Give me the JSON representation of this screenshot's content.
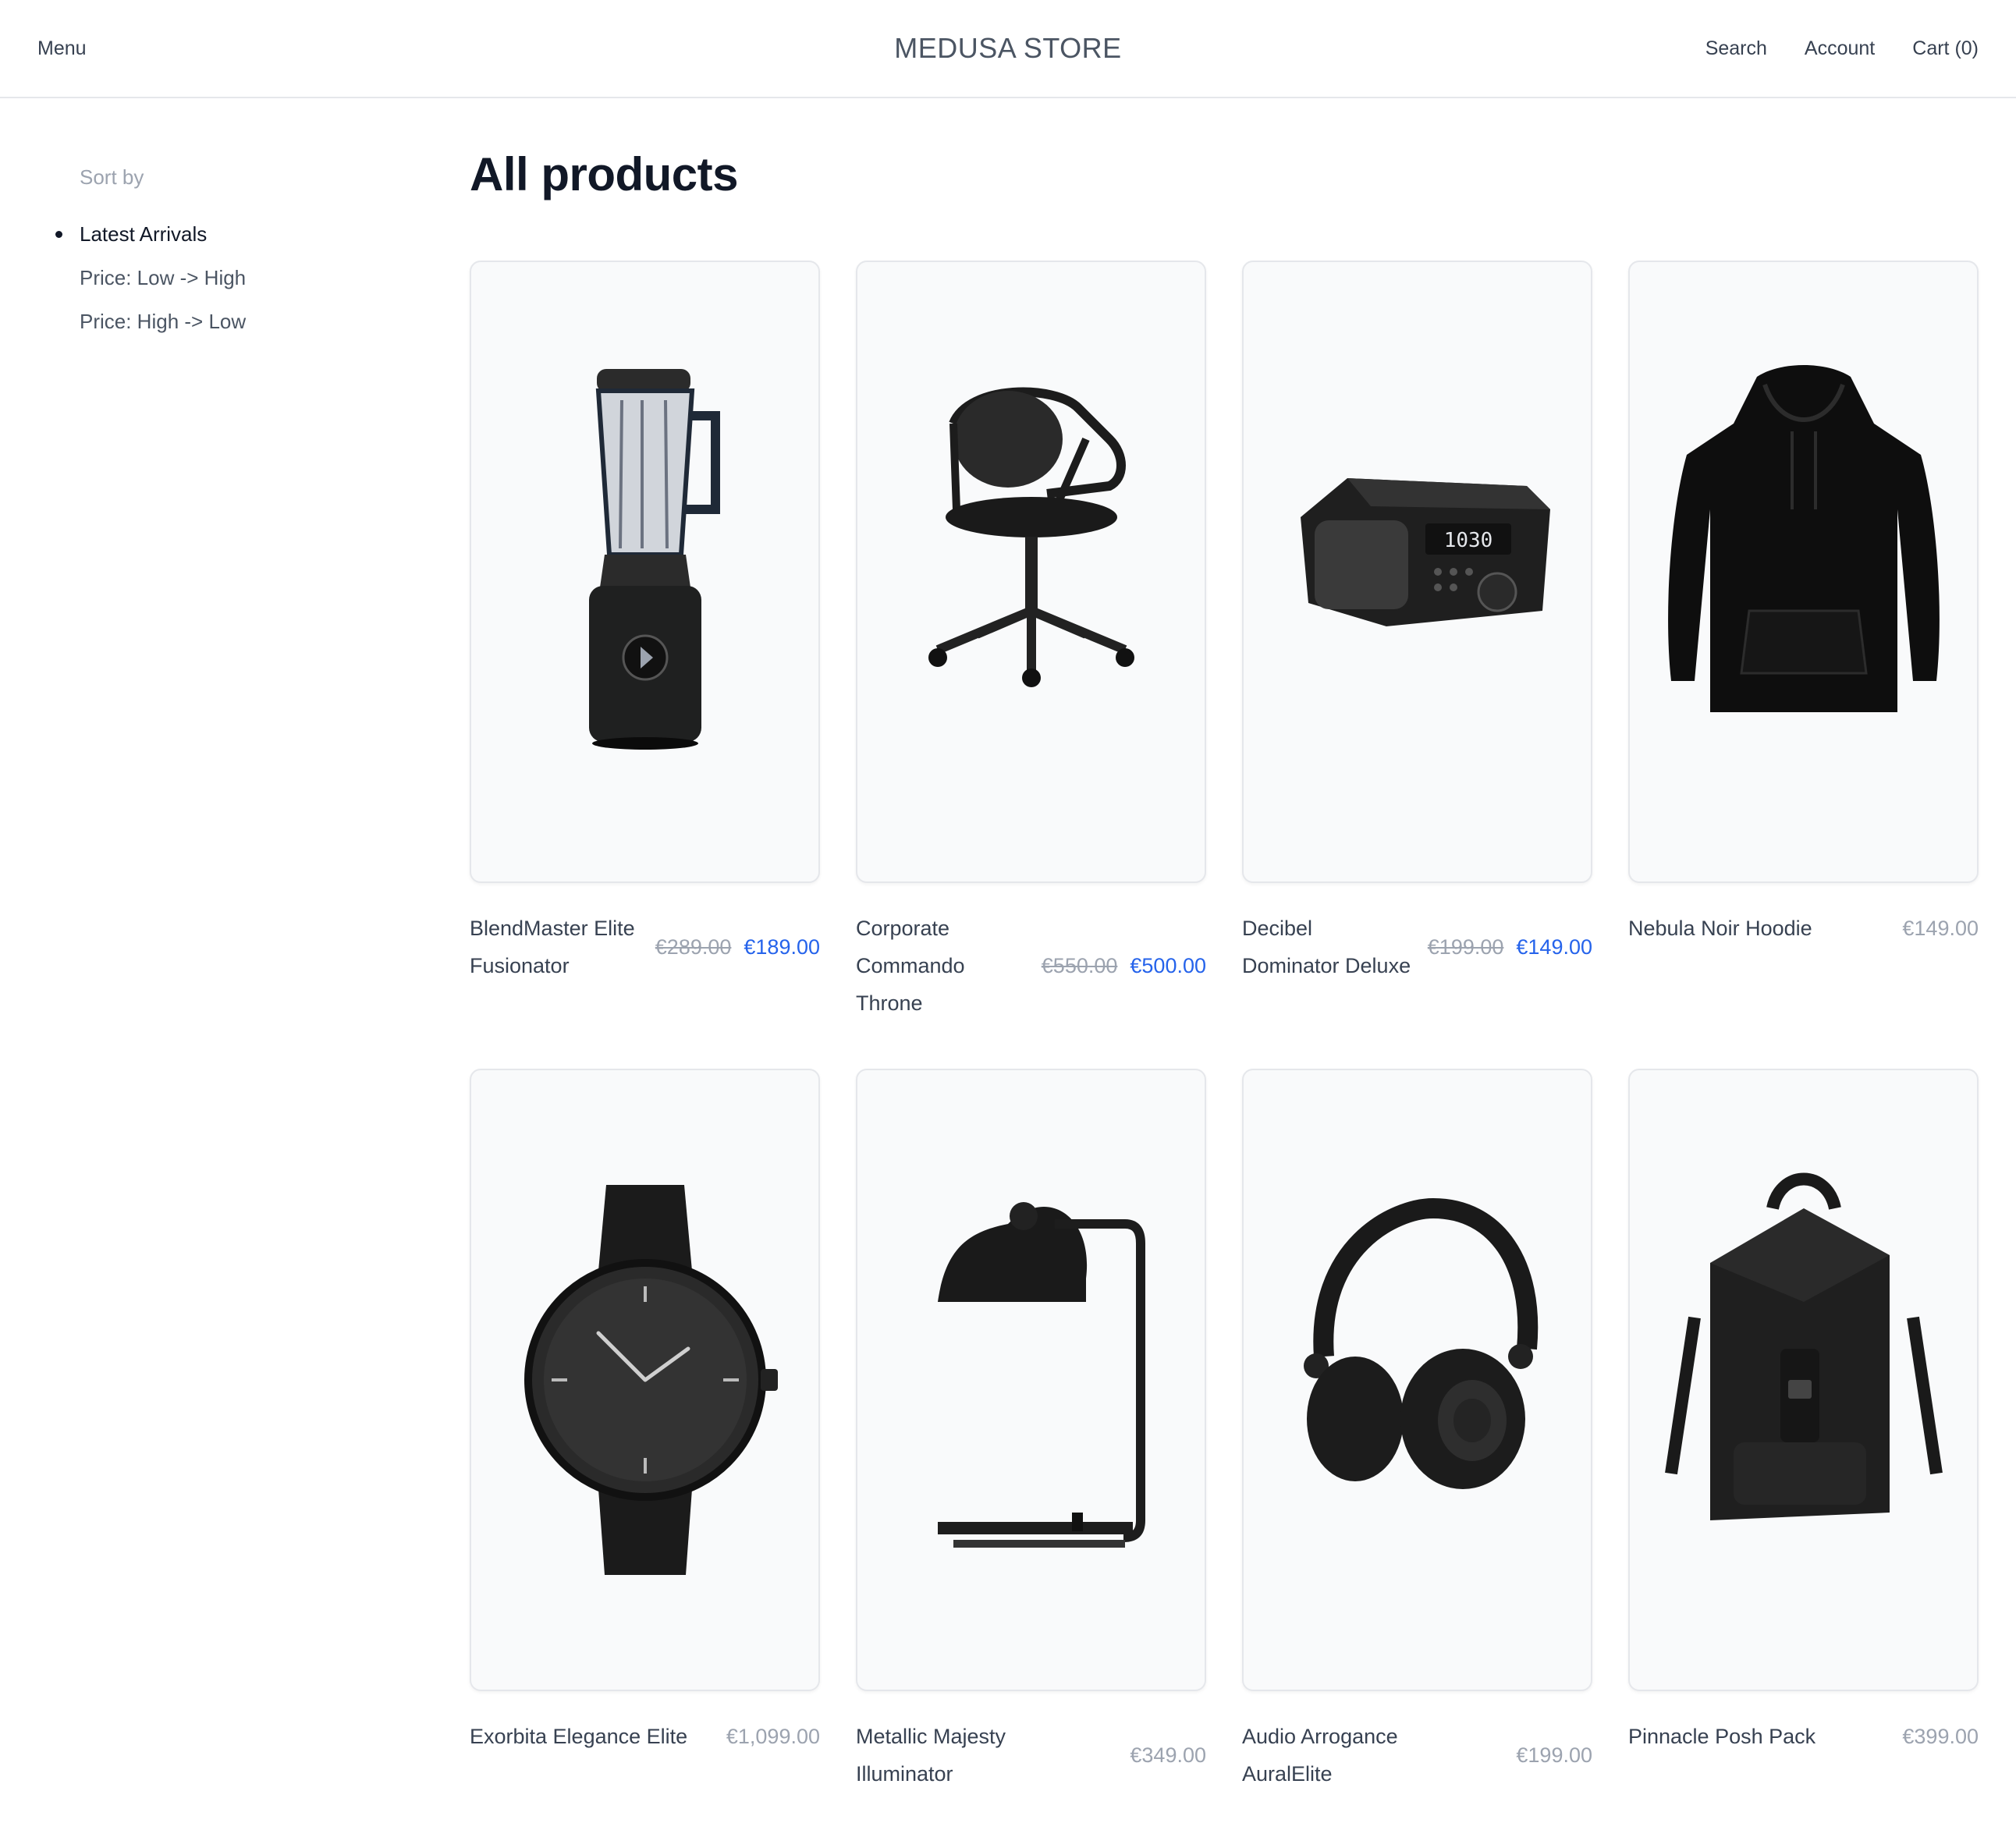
{
  "header": {
    "menu": "Menu",
    "title": "MEDUSA STORE",
    "search": "Search",
    "account": "Account",
    "cart": "Cart (0)"
  },
  "sidebar": {
    "sort_label": "Sort by",
    "options": [
      {
        "label": "Latest Arrivals",
        "selected": true
      },
      {
        "label": "Price: Low -> High",
        "selected": false
      },
      {
        "label": "Price: High -> Low",
        "selected": false
      }
    ]
  },
  "main": {
    "title": "All products",
    "products": [
      {
        "name": "BlendMaster Elite Fusionator",
        "original_price": "€289.00",
        "price": "€189.00",
        "image": "blender-image"
      },
      {
        "name": "Corporate Commando Throne",
        "original_price": "€550.00",
        "price": "€500.00",
        "image": "office-chair-image"
      },
      {
        "name": "Decibel Dominator Deluxe",
        "original_price": "€199.00",
        "price": "€149.00",
        "image": "radio-speaker-image",
        "clock_text": "1030"
      },
      {
        "name": "Nebula Noir Hoodie",
        "original_price": "",
        "price": "€149.00",
        "image": "hoodie-image"
      },
      {
        "name": "Exorbita Elegance Elite",
        "original_price": "",
        "price": "€1,099.00",
        "image": "wristwatch-image"
      },
      {
        "name": "Metallic Majesty Illuminator",
        "original_price": "",
        "price": "€349.00",
        "image": "desk-lamp-image"
      },
      {
        "name": "Audio Arrogance AuralElite",
        "original_price": "",
        "price": "€199.00",
        "image": "headphones-image"
      },
      {
        "name": "Pinnacle Posh Pack",
        "original_price": "",
        "price": "€399.00",
        "image": "backpack-image"
      }
    ]
  },
  "colors": {
    "sale_price": "#2563eb",
    "muted_price": "#9ca3af",
    "card_bg": "#f9fafb",
    "border": "#e5e7eb"
  }
}
